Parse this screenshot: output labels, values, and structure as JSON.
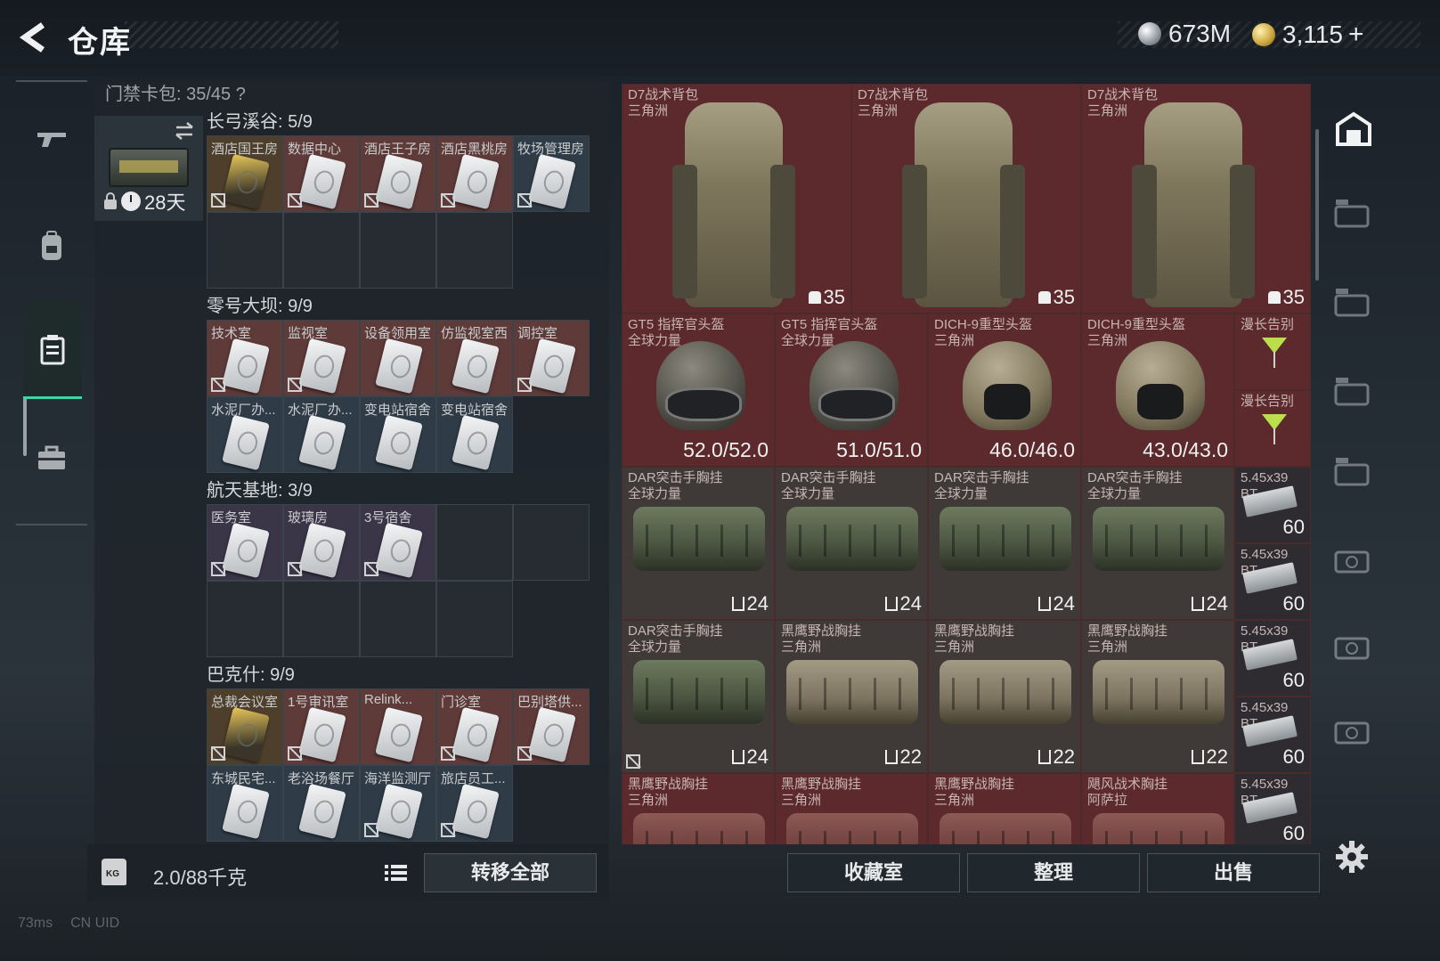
{
  "header": {
    "title": "仓库",
    "currency_silver": "673M",
    "currency_gold": "3,115",
    "currency_plus": "+"
  },
  "keycard_panel": {
    "header": "门禁卡包: 35/45 ?",
    "case_days": "28天",
    "regions": [
      {
        "title": "长弓溪谷: 5/9",
        "cards": [
          {
            "name": "酒店国王房",
            "tier": "gold"
          },
          {
            "name": "数据中心",
            "tier": "red"
          },
          {
            "name": "酒店王子房",
            "tier": "red"
          },
          {
            "name": "酒店黑桃房",
            "tier": "red"
          },
          {
            "name": "牧场管理房",
            "tier": "blue"
          }
        ]
      },
      {
        "title": "零号大坝: 9/9",
        "cards": [
          {
            "name": "技术室",
            "tier": "red"
          },
          {
            "name": "监视室",
            "tier": "red"
          },
          {
            "name": "设备领用室",
            "tier": "red"
          },
          {
            "name": "仿监视室西",
            "tier": "red"
          },
          {
            "name": "调控室",
            "tier": "red"
          },
          {
            "name": "水泥厂办...",
            "tier": "blue"
          },
          {
            "name": "水泥厂办...",
            "tier": "blue"
          },
          {
            "name": "变电站宿舍",
            "tier": "blue"
          },
          {
            "name": "变电站宿舍",
            "tier": "blue"
          }
        ]
      },
      {
        "title": "航天基地: 3/9",
        "cards": [
          {
            "name": "医务室",
            "tier": "purple"
          },
          {
            "name": "玻璃房",
            "tier": "purple"
          },
          {
            "name": "3号宿舍",
            "tier": "purple"
          }
        ]
      },
      {
        "title": "巴克什: 9/9",
        "cards": [
          {
            "name": "总裁会议室",
            "tier": "gold"
          },
          {
            "name": "1号审讯室",
            "tier": "red"
          },
          {
            "name": "Relink...",
            "tier": "red"
          },
          {
            "name": "门诊室",
            "tier": "red"
          },
          {
            "name": "巴别塔供...",
            "tier": "red"
          },
          {
            "name": "东城民宅...",
            "tier": "blue"
          },
          {
            "name": "老浴场餐厅",
            "tier": "blue"
          },
          {
            "name": "海洋监测厅",
            "tier": "blue"
          },
          {
            "name": "旅店员工...",
            "tier": "blue"
          }
        ]
      }
    ],
    "weight": "2.0/88千克",
    "transfer_all": "转移全部"
  },
  "inventory": {
    "backpacks": [
      {
        "name": "D7战术背包",
        "sub": "三角洲",
        "value": "35"
      },
      {
        "name": "D7战术背包",
        "sub": "三角洲",
        "value": "35"
      },
      {
        "name": "D7战术背包",
        "sub": "三角洲",
        "value": "35"
      }
    ],
    "helmets": [
      {
        "name": "GT5 指挥官头盔",
        "sub": "全球力量",
        "dur": "52.0/52.0"
      },
      {
        "name": "GT5 指挥官头盔",
        "sub": "全球力量",
        "dur": "51.0/51.0"
      },
      {
        "name": "DICH-9重型头盔",
        "sub": "三角洲",
        "dur": "46.0/46.0"
      },
      {
        "name": "DICH-9重型头盔",
        "sub": "三角洲",
        "dur": "43.0/43.0"
      }
    ],
    "side_items": [
      {
        "name": "漫长告别"
      },
      {
        "name": "漫长告别"
      }
    ],
    "rigs_row1": [
      {
        "name": "DAR突击手胸挂",
        "sub": "全球力量",
        "value": "24"
      },
      {
        "name": "DAR突击手胸挂",
        "sub": "全球力量",
        "value": "24"
      },
      {
        "name": "DAR突击手胸挂",
        "sub": "全球力量",
        "value": "24"
      },
      {
        "name": "DAR突击手胸挂",
        "sub": "全球力量",
        "value": "24"
      }
    ],
    "rigs_row2": [
      {
        "name": "DAR突击手胸挂",
        "sub": "全球力量",
        "value": "24"
      },
      {
        "name": "黑鹰野战胸挂",
        "sub": "三角洲",
        "value": "22"
      },
      {
        "name": "黑鹰野战胸挂",
        "sub": "三角洲",
        "value": "22"
      },
      {
        "name": "黑鹰野战胸挂",
        "sub": "三角洲",
        "value": "22"
      }
    ],
    "rigs_row3": [
      {
        "name": "黑鹰野战胸挂",
        "sub": "三角洲"
      },
      {
        "name": "黑鹰野战胸挂",
        "sub": "三角洲"
      },
      {
        "name": "黑鹰野战胸挂",
        "sub": "三角洲"
      },
      {
        "name": "飓风战术胸挂",
        "sub": "阿萨拉"
      }
    ],
    "ammo": [
      {
        "name": "5.45x39",
        "sub": "BT",
        "count": "60"
      },
      {
        "name": "5.45x39",
        "sub": "BT",
        "count": "60"
      },
      {
        "name": "5.45x39",
        "sub": "BT",
        "count": "60"
      },
      {
        "name": "5.45x39",
        "sub": "BT",
        "count": "60"
      },
      {
        "name": "5.45x39",
        "sub": "BT",
        "count": "60"
      }
    ]
  },
  "bottom_buttons": {
    "collection": "收藏室",
    "sort": "整理",
    "sell": "出售"
  },
  "status_bar": {
    "ping": "73ms",
    "uid": "CN UID"
  }
}
